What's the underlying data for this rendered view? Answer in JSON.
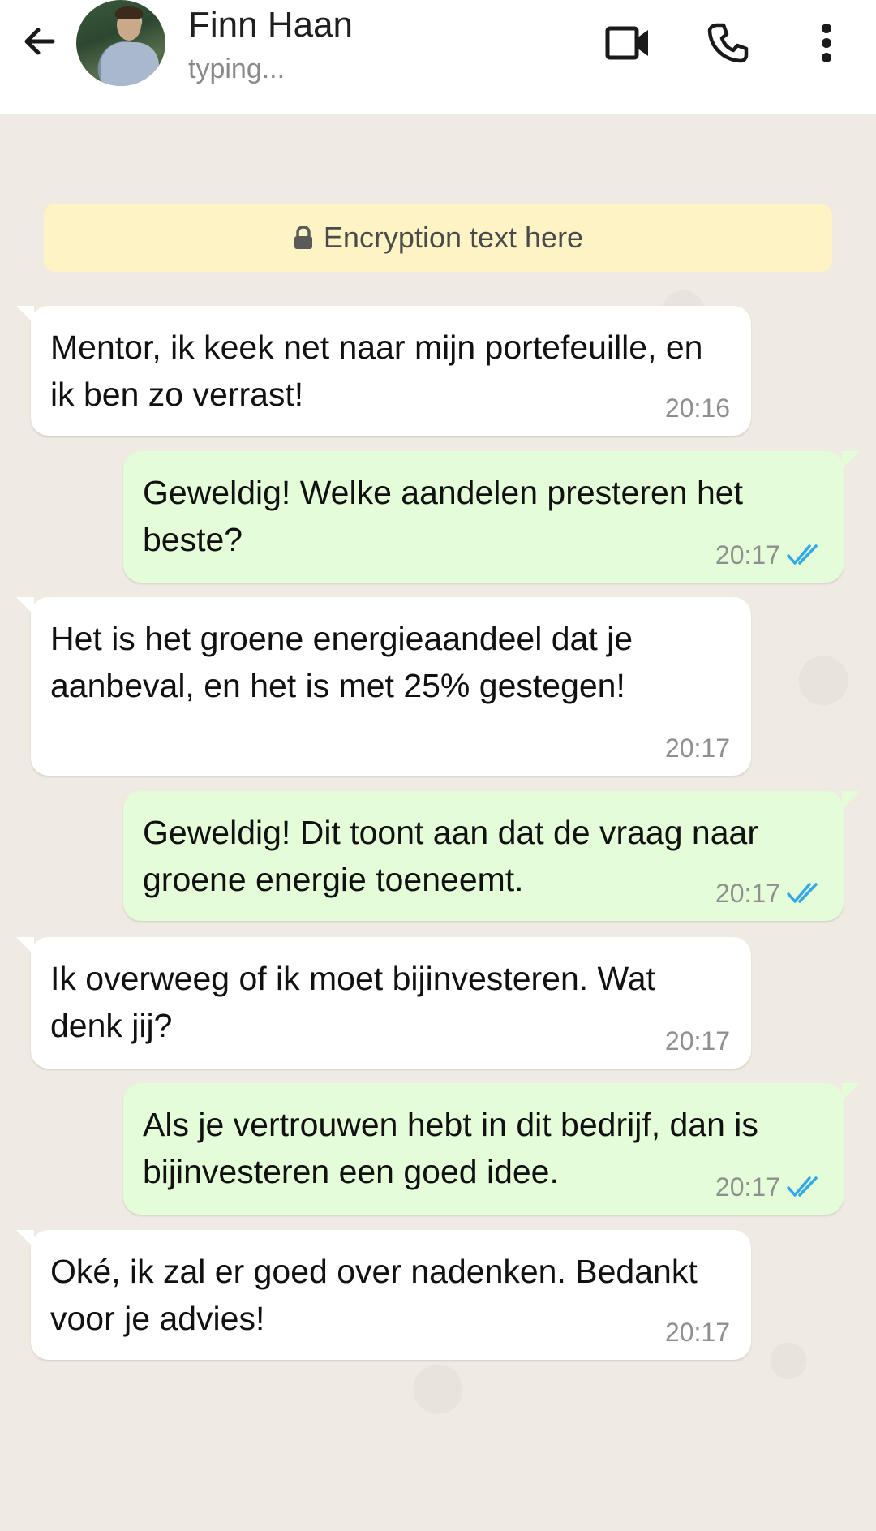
{
  "header": {
    "contact_name": "Finn Haan",
    "status": "typing..."
  },
  "encryption_notice": "Encryption text here",
  "colors": {
    "incoming_bubble": "#ffffff",
    "outgoing_bubble": "#e4fcd8",
    "read_ticks": "#34a8e8",
    "encryption_bg": "#fdf3c4",
    "chat_bg": "#efeae2"
  },
  "icons": {
    "back": "arrow-left-icon",
    "video": "video-camera-icon",
    "call": "phone-icon",
    "menu": "more-vertical-icon",
    "lock": "lock-icon",
    "read": "double-check-icon"
  },
  "messages": [
    {
      "direction": "incoming",
      "text": "Mentor, ik keek net naar mijn portefeuille, en ik ben zo verrast!",
      "time": "20:16"
    },
    {
      "direction": "outgoing",
      "text": "Geweldig! Welke aandelen presteren het beste?",
      "time": "20:17",
      "status": "read"
    },
    {
      "direction": "incoming",
      "text": "Het is het groene energieaandeel dat je aanbeval, en het is met 25% gestegen!",
      "time": "20:17"
    },
    {
      "direction": "outgoing",
      "text": "Geweldig! Dit toont aan dat de vraag naar groene energie toeneemt.",
      "time": "20:17",
      "status": "read"
    },
    {
      "direction": "incoming",
      "text": "Ik overweeg of ik moet bijinvesteren. Wat denk jij?",
      "time": "20:17"
    },
    {
      "direction": "outgoing",
      "text": "Als je vertrouwen hebt in dit bedrijf, dan is bijinvesteren een goed idee.",
      "time": "20:17",
      "status": "read"
    },
    {
      "direction": "incoming",
      "text": "Oké, ik zal er goed over nadenken. Bedankt voor je advies!",
      "time": "20:17"
    }
  ]
}
